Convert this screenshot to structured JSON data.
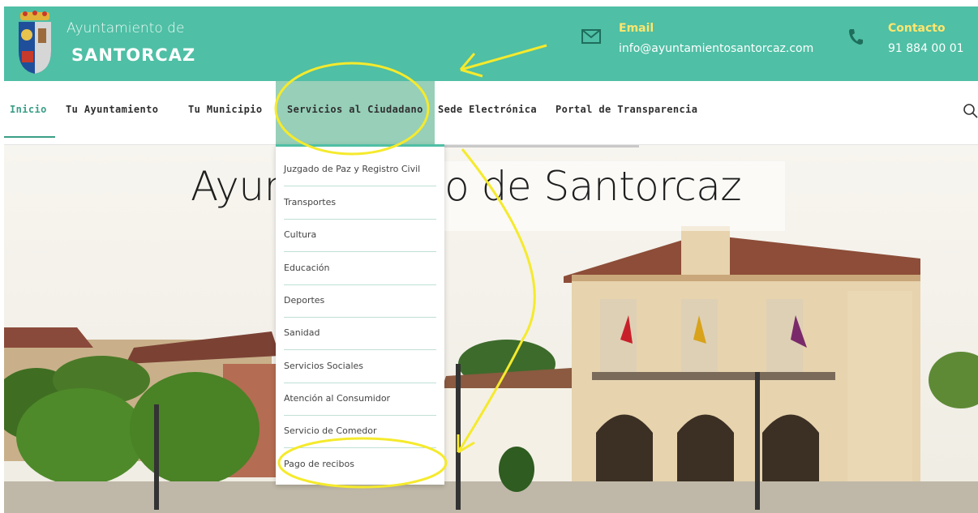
{
  "header": {
    "brand_line1": "Ayuntamiento de",
    "brand_line2": "SANTORCAZ",
    "email_title": "Email",
    "email_value": "info@ayuntamientosantorcaz.com",
    "contact_title": "Contacto",
    "contact_value": "91 884 00 01"
  },
  "nav": {
    "items": [
      {
        "label": "Inicio"
      },
      {
        "label": "Tu Ayuntamiento"
      },
      {
        "label": "Tu Municipio"
      },
      {
        "label": "Servicios al Ciudadano"
      },
      {
        "label": "Sede Electrónica"
      },
      {
        "label": "Portal de Transparencia"
      }
    ],
    "active": "Inicio",
    "open": "Servicios al Ciudadano"
  },
  "hero": {
    "title": "Ayuntamiento de Santorcaz"
  },
  "dropdown": {
    "items": [
      {
        "label": "Juzgado de Paz y Registro Civil"
      },
      {
        "label": "Transportes"
      },
      {
        "label": "Cultura"
      },
      {
        "label": "Educación"
      },
      {
        "label": "Deportes"
      },
      {
        "label": "Sanidad"
      },
      {
        "label": "Servicios Sociales"
      },
      {
        "label": "Atención al Consumidor"
      },
      {
        "label": "Servicio de Comedor"
      },
      {
        "label": "Pago de recibos"
      }
    ]
  },
  "icons": {
    "email": "envelope-icon",
    "phone": "phone-icon",
    "search": "search-icon",
    "logo": "coat-of-arms-logo"
  },
  "colors": {
    "header_bg": "#4fbfa5",
    "accent": "#3a9e86",
    "annotation": "#f5ea2c",
    "contact_title": "#ffe66d"
  }
}
